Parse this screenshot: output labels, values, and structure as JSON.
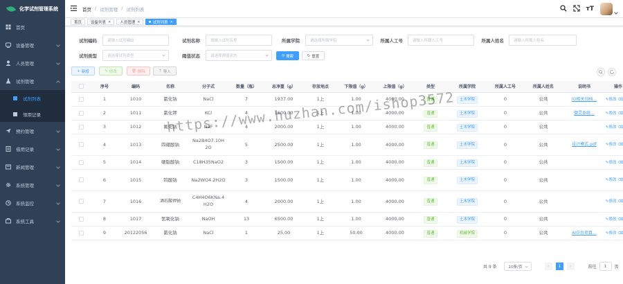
{
  "app_title": "化学试剂管理系统",
  "sidebar": [
    {
      "label": "首页",
      "icon": "dashboard-icon"
    },
    {
      "label": "设备管理",
      "icon": "device-icon"
    },
    {
      "label": "人员管理",
      "icon": "user-icon"
    },
    {
      "label": "试剂管理",
      "icon": "flask-icon",
      "open": true,
      "children": [
        {
          "label": "试剂列表",
          "active": true
        },
        {
          "label": "领用记录"
        }
      ]
    },
    {
      "label": "预约管理",
      "icon": "send-icon"
    },
    {
      "label": "借用记录",
      "icon": "record-icon"
    },
    {
      "label": "新闻管理",
      "icon": "news-icon"
    },
    {
      "label": "系统管理",
      "icon": "gear-icon"
    },
    {
      "label": "系统监控",
      "icon": "monitor-icon"
    },
    {
      "label": "系统工具",
      "icon": "tool-icon"
    }
  ],
  "breadcrumb": [
    "首页",
    "试剂管理",
    "试剂列表"
  ],
  "tags": [
    {
      "label": "首页"
    },
    {
      "label": "设备列表",
      "close": "×"
    },
    {
      "label": "人员管理",
      "close": "×"
    },
    {
      "label": "试剂列表",
      "close": "×",
      "active": true
    }
  ],
  "search": {
    "code_label": "试剂编码",
    "code_placeholder": "请输入试剂编码",
    "name_label": "试剂名称",
    "name_placeholder": "请输入试剂名称",
    "college_label": "所属学院",
    "college_placeholder": "请选择所属学院",
    "staffno_label": "所属人工号",
    "staffno_placeholder": "请输入所属人工号",
    "staffname_label": "所属人姓名",
    "staffname_placeholder": "请输入所属人姓名",
    "type_label": "试剂类型",
    "type_placeholder": "请选择试剂类型",
    "threshold_label": "阈值状态",
    "threshold_placeholder": "请选择阈值状态",
    "search_btn": "搜索",
    "reset_btn": "重置"
  },
  "toolbar": {
    "add": "新增",
    "edit": "修改",
    "delete": "删除",
    "import": "导入"
  },
  "table": {
    "headers": [
      "序号",
      "编码",
      "名称",
      "分子式",
      "数量（瓶）",
      "总净重（g）",
      "存放地点",
      "下限值（g）",
      "上限值（g）",
      "类型",
      "所属学院",
      "所属人工号",
      "所属人姓名",
      "说明书",
      "操作"
    ],
    "rows": [
      [
        "1",
        "1010",
        "氯化钠",
        "NaCl",
        "7",
        "1937.00",
        "1上",
        "1.00",
        "4000.00",
        "普通",
        "土木学院",
        "0",
        "公共",
        "IO相关归档..."
      ],
      [
        "2",
        "1011",
        "氯化钾",
        "KCl",
        "4",
        "1600.00",
        "1上",
        "1.00",
        "4000.00",
        "普通",
        "土木学院",
        "0",
        "公共",
        "御灵系统..."
      ],
      [
        "3",
        "1012",
        "氟化钠",
        "NaF",
        "4",
        "2000.00",
        "1上",
        "1.00",
        "4000.00",
        "普通",
        "土木学院",
        "0",
        "公共",
        ""
      ],
      [
        "4",
        "1013",
        "四硼酸钠",
        "Na2B4O7.10H2O",
        "5",
        "2500.00",
        "1上",
        "1.00",
        "4000.00",
        "普通",
        "土木学院",
        "0",
        "公共",
        "设计模式.pdf"
      ],
      [
        "5",
        "1014",
        "硬脂酸钠",
        "C18H35NaO2",
        "3",
        "1500.00",
        "1上",
        "1.00",
        "4000.00",
        "普通",
        "土木学院",
        "0",
        "公共",
        ""
      ],
      [
        "6",
        "1015",
        "钨酸钠",
        "Na2WO4.2H2O",
        "3",
        "1500.00",
        "1上",
        "1.00",
        "4000.00",
        "普通",
        "土木学院",
        "0",
        "公共",
        ""
      ],
      [
        "7",
        "1016",
        "酒石酸钾钠",
        "C4H4O6KNa.4H2O",
        "4",
        "2000.00",
        "1上",
        "1.00",
        "4000.00",
        "普通",
        "土木学院",
        "0",
        "公共",
        ""
      ],
      [
        "8",
        "1017",
        "氢氧化钠",
        "NaOH",
        "13",
        "6500.00",
        "1上",
        "1.00",
        "4000.00",
        "普通",
        "土木学院",
        "0",
        "公共",
        ""
      ],
      [
        "9",
        "20122056",
        "氯化钠",
        "NaCl",
        "1",
        "25.00",
        "1上",
        "50.00",
        "4000.00",
        "普通",
        "机械学院",
        "0",
        "公共",
        "AI中台项目..."
      ]
    ],
    "op_edit": "修改",
    "op_delete": "删除"
  },
  "pagination": {
    "total": "共 9 条",
    "page_size": "10条/页",
    "current": "1",
    "goto_label": "前往",
    "goto_value": "1",
    "goto_unit": "页"
  },
  "watermark": "https://www.huzhan.com/ishop3572"
}
